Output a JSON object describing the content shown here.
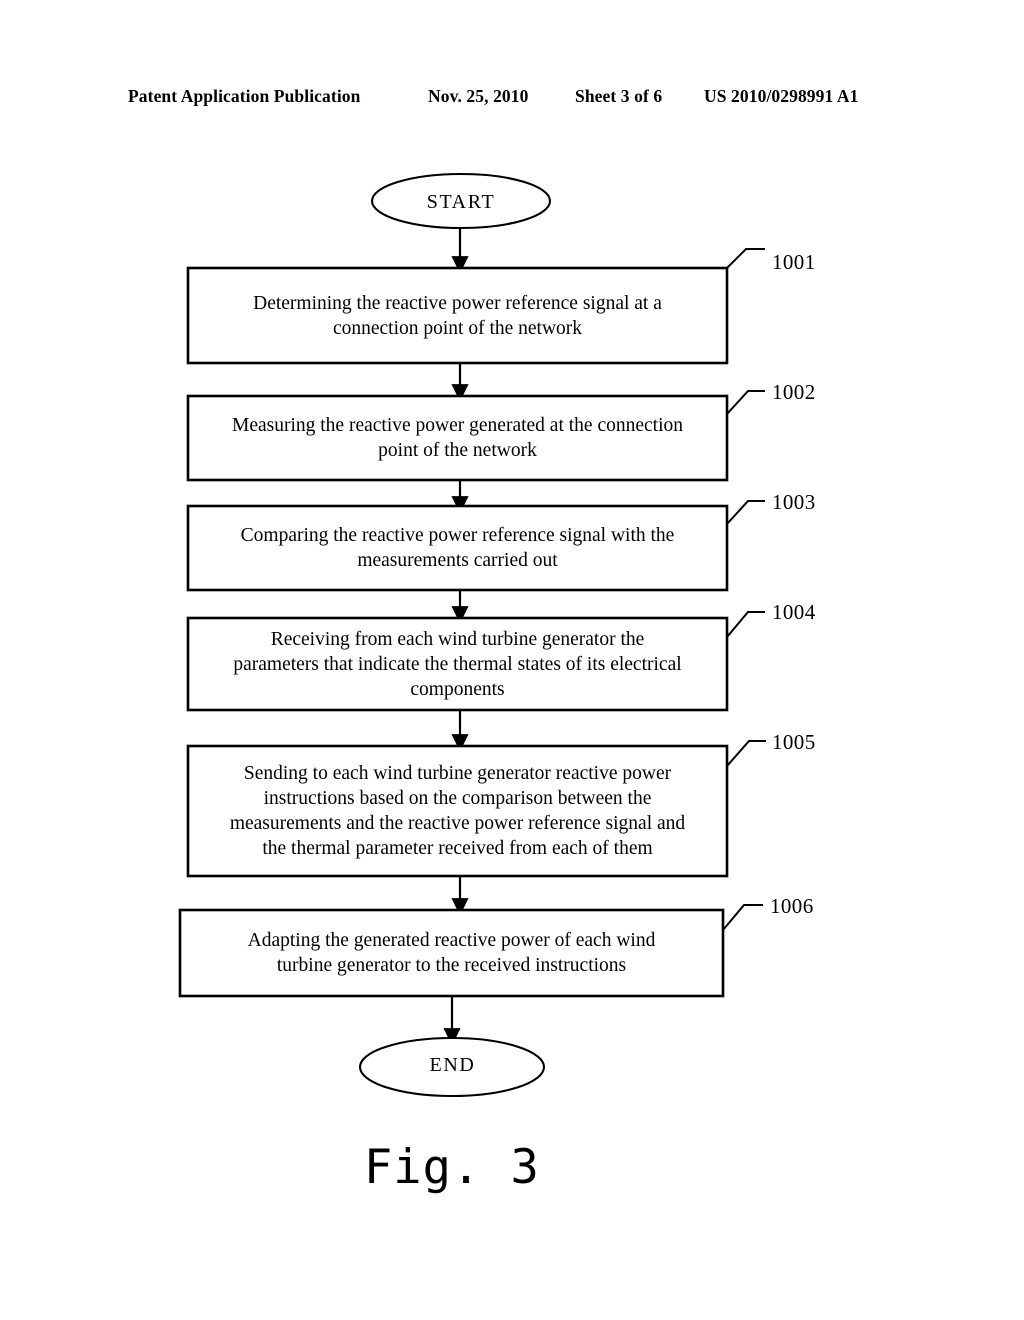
{
  "header": {
    "publication": "Patent Application Publication",
    "date": "Nov. 25, 2010",
    "sheet": "Sheet 3 of 6",
    "document_number": "US 2010/0298991 A1"
  },
  "figure": {
    "caption": "Fig. 3",
    "start_label": "START",
    "end_label": "END",
    "steps": [
      {
        "ref": "1001",
        "lines": [
          "Determining the reactive power reference signal at a",
          "connection point of the network"
        ]
      },
      {
        "ref": "1002",
        "lines": [
          "Measuring the reactive power generated at the connection",
          "point of the network"
        ]
      },
      {
        "ref": "1003",
        "lines": [
          "Comparing the reactive power reference signal with the",
          "measurements carried out"
        ]
      },
      {
        "ref": "1004",
        "lines": [
          "Receiving from each wind turbine generator the",
          "parameters that indicate the thermal states of its electrical",
          "components"
        ]
      },
      {
        "ref": "1005",
        "lines": [
          "Sending to each wind turbine generator reactive power",
          "instructions based on the comparison between the",
          "measurements and the reactive power reference signal and",
          "the thermal parameter received from each of them"
        ]
      },
      {
        "ref": "1006",
        "lines": [
          "Adapting the generated reactive power of each wind",
          "turbine generator to the received instructions"
        ]
      }
    ]
  },
  "colors": {
    "ink": "#000000",
    "paper": "#ffffff"
  }
}
